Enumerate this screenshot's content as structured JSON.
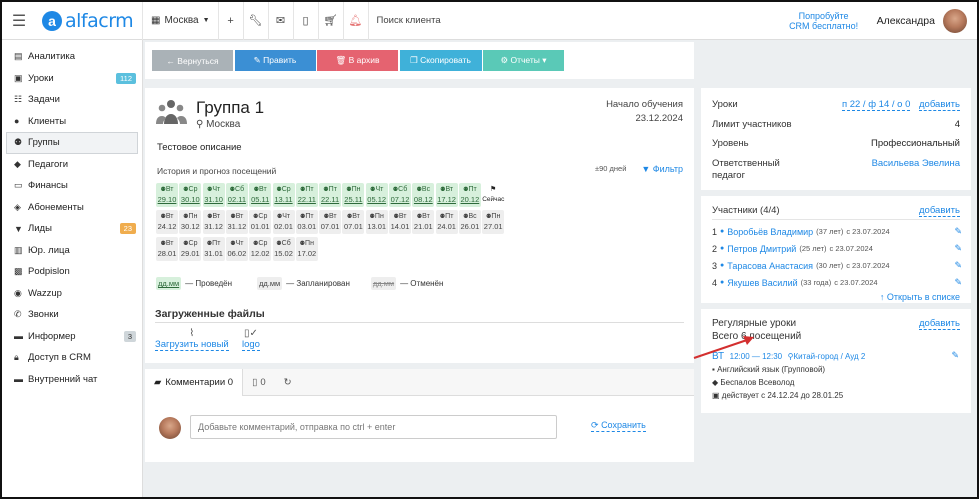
{
  "header": {
    "logo_text": "alfacrm",
    "city": "Москва",
    "search_placeholder": "Поиск клиента",
    "promo_line1": "Попробуйте",
    "promo_line2": "CRM бесплатно!",
    "user_name": "Александра"
  },
  "sidebar": {
    "items": [
      {
        "label": "Аналитика",
        "icon": "chart-icon"
      },
      {
        "label": "Уроки",
        "icon": "calendar-icon",
        "badge": "112"
      },
      {
        "label": "Задачи",
        "icon": "tasks-icon"
      },
      {
        "label": "Клиенты",
        "icon": "user-icon"
      },
      {
        "label": "Группы",
        "icon": "users-icon"
      },
      {
        "label": "Педагоги",
        "icon": "graduation-cap-icon"
      },
      {
        "label": "Финансы",
        "icon": "money-icon"
      },
      {
        "label": "Абонементы",
        "icon": "tag-icon"
      },
      {
        "label": "Лиды",
        "icon": "funnel-icon",
        "badge": "23"
      },
      {
        "label": "Юр. лица",
        "icon": "building-icon"
      },
      {
        "label": "Podpislon",
        "icon": "podpislon-icon"
      },
      {
        "label": "Wazzup",
        "icon": "whatsapp-icon"
      },
      {
        "label": "Звонки",
        "icon": "phone-icon"
      },
      {
        "label": "Информер",
        "icon": "informer-icon",
        "badge": "3"
      },
      {
        "label": "Доступ в CRM",
        "icon": "lock-icon"
      },
      {
        "label": "Внутренний чат",
        "icon": "chat-icon"
      }
    ]
  },
  "actions": {
    "back": "← Вернуться",
    "edit": "✎ Править",
    "archive": "🗑 В архив",
    "copy": "❐ Скопировать",
    "reports": "⚙ Отчеты ▾"
  },
  "group": {
    "title": "Группа 1",
    "city": "Москва",
    "start_label": "Начало обучения",
    "start_date": "23.12.2024",
    "description": "Тестовое описание",
    "history_label": "История и прогноз посещений",
    "days": "±90 дней",
    "filter": "Фильтр"
  },
  "calendar": {
    "row1": [
      {
        "d": "Вт",
        "n": "29.10",
        "s": "done"
      },
      {
        "d": "Ср",
        "n": "30.10",
        "s": "done"
      },
      {
        "d": "Чт",
        "n": "31.10",
        "s": "done"
      },
      {
        "d": "Сб",
        "n": "02.11",
        "s": "done"
      },
      {
        "d": "Вт",
        "n": "05.11",
        "s": "done"
      },
      {
        "d": "Ср",
        "n": "13.11",
        "s": "done"
      },
      {
        "d": "Пт",
        "n": "22.11",
        "s": "done"
      },
      {
        "d": "Пт",
        "n": "22.11",
        "s": "done"
      },
      {
        "d": "Пн",
        "n": "25.11",
        "s": "done"
      },
      {
        "d": "Чт",
        "n": "05.12",
        "s": "done"
      },
      {
        "d": "Сб",
        "n": "07.12",
        "s": "done"
      },
      {
        "d": "Вс",
        "n": "08.12",
        "s": "done"
      },
      {
        "d": "Вт",
        "n": "17.12",
        "s": "done"
      },
      {
        "d": "Пт",
        "n": "20.12",
        "s": "done"
      },
      {
        "d": "",
        "n": "Сейчас",
        "s": "now"
      }
    ],
    "row2": [
      {
        "d": "Вт",
        "n": "24.12"
      },
      {
        "d": "Пн",
        "n": "30.12"
      },
      {
        "d": "Вт",
        "n": "31.12"
      },
      {
        "d": "Вт",
        "n": "31.12"
      },
      {
        "d": "Ср",
        "n": "01.01"
      },
      {
        "d": "Чт",
        "n": "02.01"
      },
      {
        "d": "Пт",
        "n": "03.01"
      },
      {
        "d": "Вт",
        "n": "07.01"
      },
      {
        "d": "Вт",
        "n": "07.01"
      },
      {
        "d": "Пн",
        "n": "13.01"
      },
      {
        "d": "Вт",
        "n": "14.01"
      },
      {
        "d": "Вт",
        "n": "21.01"
      },
      {
        "d": "Пт",
        "n": "24.01"
      },
      {
        "d": "Вс",
        "n": "26.01"
      },
      {
        "d": "Пн",
        "n": "27.01"
      }
    ],
    "row3": [
      {
        "d": "Вт",
        "n": "28.01"
      },
      {
        "d": "Ср",
        "n": "29.01"
      },
      {
        "d": "Пт",
        "n": "31.01"
      },
      {
        "d": "Чт",
        "n": "06.02"
      },
      {
        "d": "Ср",
        "n": "12.02"
      },
      {
        "d": "Сб",
        "n": "15.02"
      },
      {
        "d": "Пн",
        "n": "17.02"
      }
    ],
    "legend_sample": "дд.мм",
    "legend_done": "— Проведён",
    "legend_planned": "— Запланирован",
    "legend_cancelled": "— Отменён"
  },
  "files": {
    "heading": "Загруженные файлы",
    "upload": "Загрузить новый",
    "file_name": "logo"
  },
  "comments": {
    "tab_comments": "Комментарии 0",
    "tab_files": "0",
    "input_placeholder": "Добавьте комментарий, отправка по ctrl + enter",
    "save": "Сохранить"
  },
  "info": {
    "lessons_label": "Уроки",
    "lessons_value": "п 22 / ф 14 / о 0",
    "lessons_add": "добавить",
    "limit_label": "Лимит участников",
    "limit_value": "4",
    "level_label": "Уровень",
    "level_value": "Профессиональный",
    "teacher_label1": "Ответственный",
    "teacher_label2": "педагог",
    "teacher_value": "Васильева Эвелина"
  },
  "members": {
    "heading": "Участники (4/4)",
    "add": "добавить",
    "list": [
      {
        "n": "1",
        "name": "Воробьёв Владимир",
        "age": "(37 лет)",
        "since": "с 23.07.2024"
      },
      {
        "n": "2",
        "name": "Петров Дмитрий",
        "age": "(25 лет)",
        "since": "с 23.07.2024"
      },
      {
        "n": "3",
        "name": "Тарасова Анастасия",
        "age": "(30 лет)",
        "since": "с 23.07.2024"
      },
      {
        "n": "4",
        "name": "Якушев Василий",
        "age": "(33 года)",
        "since": "с 23.07.2024"
      }
    ],
    "open_list": "Открыть в списке"
  },
  "regular": {
    "heading": "Регулярные уроки",
    "add": "добавить",
    "total": "Всего 6 посещений",
    "day": "ВТ",
    "time": "12:00 — 12:30",
    "place": "Китай-город / Ауд 2",
    "subject": "Английский язык (Групповой)",
    "teacher": "Беспалов Всеволод",
    "period": "действует с 24.12.24 до 28.01.25"
  },
  "colors": {
    "accent": "#1e88e5",
    "done": "#d7f0dc",
    "arrow": "#d32f2f"
  }
}
